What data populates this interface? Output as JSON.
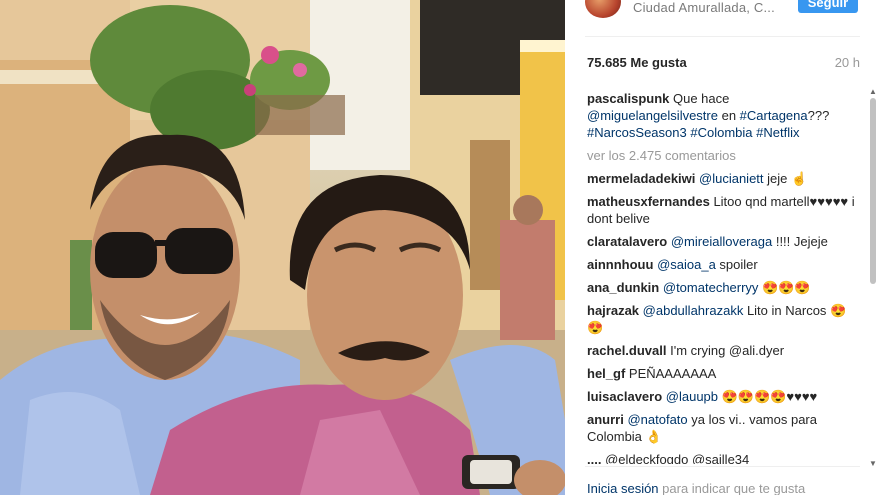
{
  "post": {
    "location": "Ciudad Amurallada, C...",
    "follow_label": "Seguir",
    "likes": "75.685 Me gusta",
    "time": "20 h"
  },
  "caption": {
    "user": "pascalispunk",
    "text1": " Que hace ",
    "mention": "@miguelangelsilvestre",
    "text2": " en ",
    "tag1": "#Cartagena",
    "text3": "???",
    "tag2": "#NarcosSeason3",
    "tag3": "#Colombia",
    "tag4": "#Netflix"
  },
  "more_comments": "ver los 2.475 comentarios",
  "comments": [
    {
      "user": "mermeladadekiwi",
      "mention": "@lucianiett",
      "text": " jeje ☝"
    },
    {
      "user": "matheusxfernandes",
      "mention": "",
      "text": " Litoo qnd martell♥♥♥♥♥ i dont belive"
    },
    {
      "user": "claratalavero",
      "mention": "@mireialloveraga",
      "text": " !!!! Jejeje"
    },
    {
      "user": "ainnnhouu",
      "mention": "@saioa_a",
      "text": " spoiler"
    },
    {
      "user": "ana_dunkin",
      "mention": "@tomatecherryy",
      "text": " 😍😍😍"
    },
    {
      "user": "hajrazak",
      "mention": "@abdullahrazakk",
      "text": " Lito in Narcos 😍😍"
    },
    {
      "user": "rachel.duvall",
      "mention": "",
      "text": " I'm crying @ali.dyer"
    },
    {
      "user": "hel_gf",
      "mention": "",
      "text": " PEÑAAAAAAA"
    },
    {
      "user": "luisaclavero",
      "mention": "@lauupb",
      "text": " 😍😍😍😍♥♥♥♥"
    },
    {
      "user": "anurri",
      "mention": "@natofato",
      "text": " ya los vi.. vamos para Colombia 👌"
    },
    {
      "user": "....",
      "mention": "",
      "text": " @eldeckfogdo @saille34"
    }
  ],
  "footer": {
    "login": "Inicia sesión",
    "rest": " para indicar que te gusta"
  },
  "colors": {
    "accent": "#3897f0",
    "link": "#003569",
    "muted": "#999999"
  }
}
